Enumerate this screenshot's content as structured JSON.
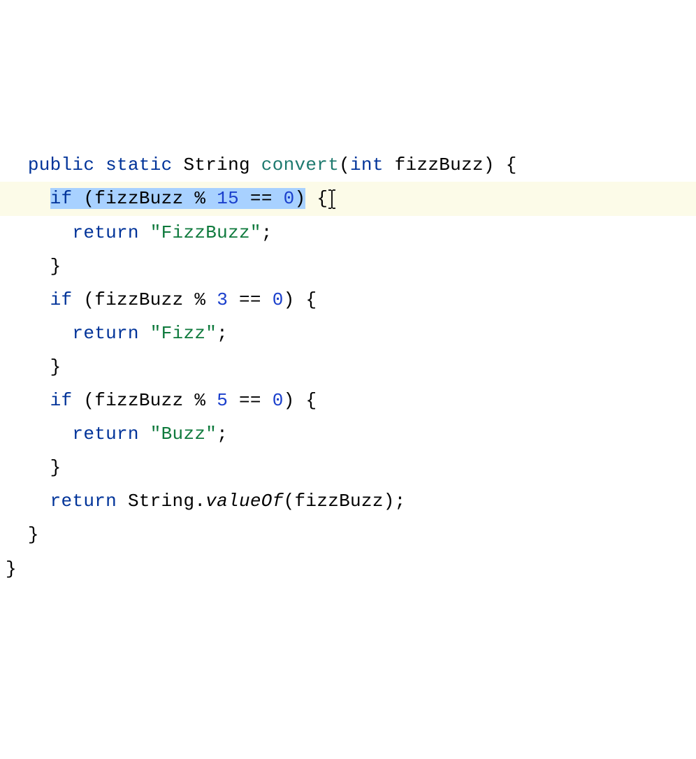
{
  "code": {
    "line1": {
      "kw_public": "public",
      "kw_static": "static",
      "type_string": "String",
      "method_name": "convert",
      "kw_int": "int",
      "param": "fizzBuzz",
      "close": ") {"
    },
    "line2": {
      "kw_if": "if",
      "open": " (",
      "param": "fizzBuzz",
      "op": " % ",
      "num": "15",
      "eq": " == ",
      "zero": "0",
      "close_paren": ")",
      "brace": " {"
    },
    "line3": {
      "kw_return": "return",
      "str": "\"FizzBuzz\"",
      "semi": ";"
    },
    "line4": {
      "brace": "}"
    },
    "line5": {
      "kw_if": "if",
      "open": " (",
      "param": "fizzBuzz",
      "op": " % ",
      "num": "3",
      "eq": " == ",
      "zero": "0",
      "close": ") {"
    },
    "line6": {
      "kw_return": "return",
      "str": "\"Fizz\"",
      "semi": ";"
    },
    "line7": {
      "brace": "}"
    },
    "line8": {
      "kw_if": "if",
      "open": " (",
      "param": "fizzBuzz",
      "op": " % ",
      "num": "5",
      "eq": " == ",
      "zero": "0",
      "close": ") {"
    },
    "line9": {
      "kw_return": "return",
      "str": "\"Buzz\"",
      "semi": ";"
    },
    "line10": {
      "brace": "}"
    },
    "line11": {
      "kw_return": "return",
      "cls": " String",
      "dot": ".",
      "method": "valueOf",
      "open": "(",
      "param": "fizzBuzz",
      "close": ");"
    },
    "line12": {
      "brace": "}"
    },
    "line13": {
      "brace": "}"
    }
  },
  "colors": {
    "keyword": "#003399",
    "method": "#1e7a6f",
    "number": "#1a3fcc",
    "string": "#0f7a3d",
    "highlight_bg": "#fcfbe8",
    "selection_bg": "#a8d1ff"
  }
}
